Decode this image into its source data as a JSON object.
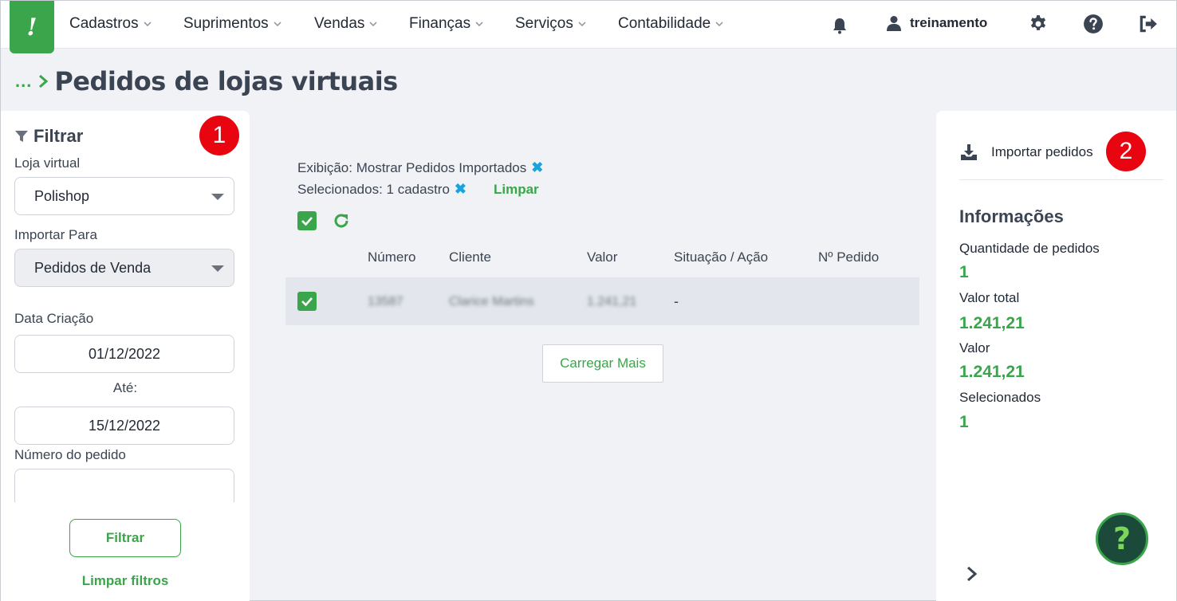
{
  "logo": {
    "glyph": "!"
  },
  "nav": {
    "items": [
      {
        "label": "Cadastros"
      },
      {
        "label": "Suprimentos"
      },
      {
        "label": "Vendas"
      },
      {
        "label": "Finanças"
      },
      {
        "label": "Serviços"
      },
      {
        "label": "Contabilidade"
      }
    ],
    "icons": [
      "bell-icon",
      "user-icon",
      "gear-icon",
      "help-icon",
      "logout-icon"
    ],
    "username": "treinamento"
  },
  "page": {
    "breadcrumb_dots": "...",
    "title": "Pedidos de lojas virtuais"
  },
  "filter": {
    "title": "Filtrar",
    "badge": "1",
    "loja_label": "Loja virtual",
    "loja_value": "Polishop",
    "importar_label": "Importar Para",
    "importar_value": "Pedidos de Venda",
    "data_label": "Data Criação",
    "data_inicio": "01/12/2022",
    "ate_label": "Até:",
    "data_fim": "15/12/2022",
    "numero_label": "Número do pedido",
    "numero_value": "",
    "btn_filtrar": "Filtrar",
    "limpar_filtros": "Limpar filtros"
  },
  "chips": {
    "exibicao": "Exibição: Mostrar Pedidos Importados",
    "selecionados": "Selecionados: 1 cadastro",
    "close_glyph": "✖",
    "limpar": "Limpar"
  },
  "table": {
    "headers": [
      "Número",
      "Cliente",
      "Valor",
      "Situação / Ação",
      "Nº Pedido"
    ],
    "rows": [
      {
        "numero": "13587",
        "cliente": "Clarice Martins",
        "valor": "1.241,21",
        "situacao": "-",
        "pedido": "",
        "checked": true
      }
    ]
  },
  "load_more": "Carregar Mais",
  "right": {
    "import_label": "Importar pedidos",
    "badge": "2",
    "info_title": "Informações",
    "qtd_label": "Quantidade de pedidos",
    "qtd_value": "1",
    "valor_total_label": "Valor total",
    "valor_total_value": "1.241,21",
    "valor_label": "Valor",
    "valor_value": "1.241,21",
    "selecionados_label": "Selecionados",
    "selecionados_value": "1"
  },
  "help_glyph": "?",
  "colors": {
    "brand_green": "#3aa54a",
    "badge_red": "#e8050f",
    "close_blue": "#1aa3dc",
    "fab_dark": "#1c4a3a"
  }
}
